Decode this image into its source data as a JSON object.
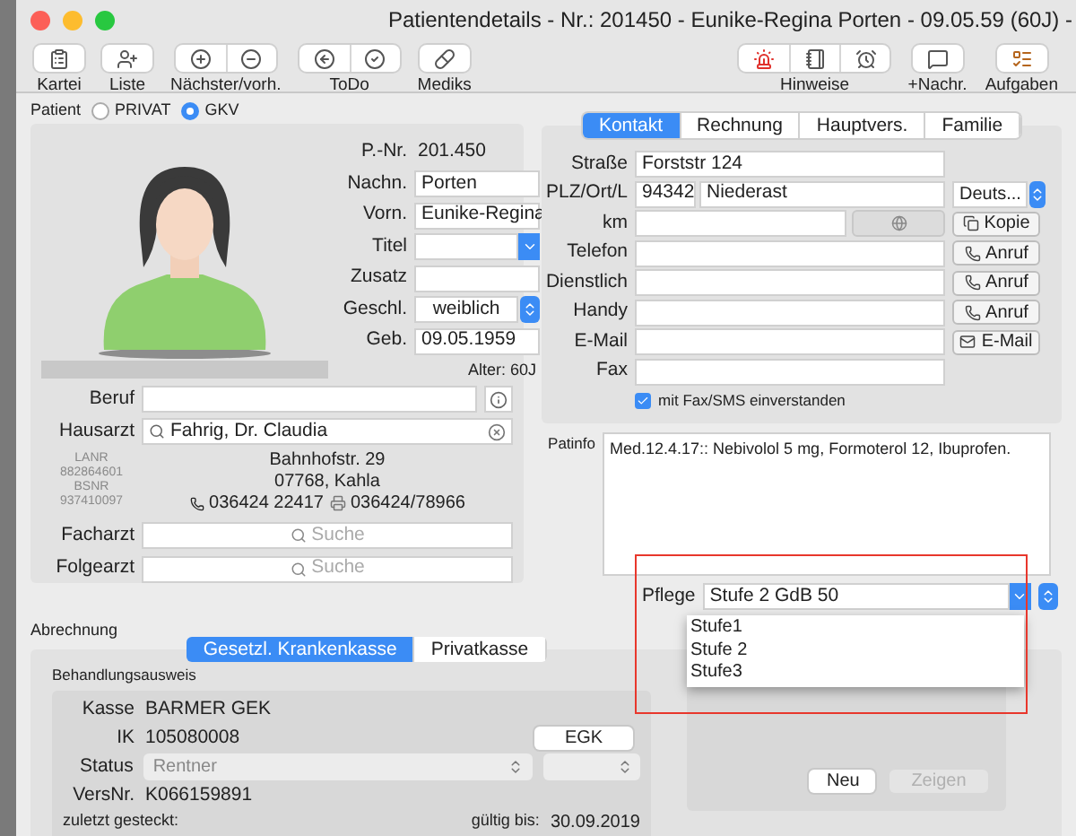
{
  "window": {
    "title": "Patientendetails - Nr.: 201450 - Eunike-Regina Porten - 09.05.59 (60J) -"
  },
  "toolbar": {
    "left": [
      {
        "label": "Kartei"
      },
      {
        "label": "Liste"
      },
      {
        "label": "Nächster/vorh."
      },
      {
        "label": "ToDo"
      },
      {
        "label": "Mediks"
      }
    ],
    "right": [
      {
        "label": "Hinweise"
      },
      {
        "label": "+Nachr."
      },
      {
        "label": "Aufgaben"
      }
    ]
  },
  "patient_type": {
    "label": "Patient",
    "options": [
      {
        "label": "PRIVAT",
        "selected": false
      },
      {
        "label": "GKV",
        "selected": true
      }
    ]
  },
  "personal": {
    "fields": [
      {
        "kind": "readonly",
        "label": "P.-Nr.",
        "value": "201.450"
      },
      {
        "kind": "text",
        "label": "Nachn.",
        "value": "Porten"
      },
      {
        "kind": "text",
        "label": "Vorn.",
        "value": "Eunike-Regina"
      },
      {
        "kind": "combo",
        "label": "Titel"
      },
      {
        "kind": "text",
        "label": "Zusatz"
      },
      {
        "kind": "select",
        "label": "Geschl.",
        "value": "weiblich"
      },
      {
        "kind": "text",
        "label": "Geb.",
        "value": "09.05.1959"
      }
    ],
    "age": "Alter: 60J"
  },
  "doctors": {
    "beruf": {
      "label": "Beruf"
    },
    "hausarzt": {
      "label": "Hausarzt",
      "value": "Fahrig, Dr. Claudia"
    },
    "ids": [
      {
        "label": "LANR",
        "value": "882864601"
      },
      {
        "label": "BSNR",
        "value": "937410097"
      }
    ],
    "address": [
      "Bahnhofstr. 29",
      "07768, Kahla"
    ],
    "phone": "036424 22417",
    "fax": "036424/78966",
    "search_fields": [
      {
        "label": "Facharzt",
        "placeholder": "Suche"
      },
      {
        "label": "Folgearzt",
        "placeholder": "Suche"
      }
    ]
  },
  "contact_tabs": [
    {
      "label": "Kontakt",
      "selected": true
    },
    {
      "label": "Rechnung",
      "selected": false
    },
    {
      "label": "Hauptvers.",
      "selected": false
    },
    {
      "label": "Familie",
      "selected": false
    }
  ],
  "contact": {
    "rows": [
      {
        "kind": "text",
        "label": "Straße",
        "value": "Forststr 124"
      },
      {
        "kind": "address",
        "label": "PLZ/Ort/L",
        "zip": "94342",
        "city": "Niederast",
        "country": "Deuts..."
      },
      {
        "kind": "km",
        "label": "km",
        "button": "Kopie"
      },
      {
        "kind": "phone",
        "label": "Telefon",
        "button": "Anruf"
      },
      {
        "kind": "phone",
        "label": "Dienstlich",
        "button": "Anruf"
      },
      {
        "kind": "phone",
        "label": "Handy",
        "button": "Anruf"
      },
      {
        "kind": "email",
        "label": "E-Mail",
        "button": "E-Mail"
      },
      {
        "kind": "text",
        "label": "Fax"
      }
    ],
    "consent": {
      "label": "mit Fax/SMS einverstanden",
      "checked": true
    }
  },
  "patinfo": {
    "label": "Patinfo",
    "value": "Med.12.4.17:: Nebivolol 5 mg, Formoterol 12, Ibuprofen."
  },
  "pflege": {
    "label": "Pflege",
    "value": "Stufe 2 GdB 50",
    "open": true,
    "options": [
      "Stufe1",
      "Stufe 2",
      "Stufe3"
    ]
  },
  "billing": {
    "title": "Abrechnung",
    "tabs": [
      {
        "label": "Gesetzl. Krankenkasse",
        "selected": true
      },
      {
        "label": "Privatkasse",
        "selected": false
      }
    ],
    "card_title": "Behandlungsausweis",
    "rows": [
      {
        "kind": "text",
        "label": "Kasse",
        "value": "BARMER GEK"
      },
      {
        "kind": "text",
        "label": "IK",
        "value": "105080008"
      },
      {
        "kind": "select",
        "label": "Status",
        "value": "Rentner",
        "disabled": true
      },
      {
        "kind": "text",
        "label": "VersNr.",
        "value": "K066159891"
      }
    ],
    "egk_button": "EGK",
    "last_inserted": "zuletzt gesteckt:",
    "valid_label": "gültig bis:",
    "valid_value": "30.09.2019",
    "buttons": [
      {
        "label": "Neu",
        "disabled": false
      },
      {
        "label": "Zeigen",
        "disabled": true
      }
    ]
  }
}
